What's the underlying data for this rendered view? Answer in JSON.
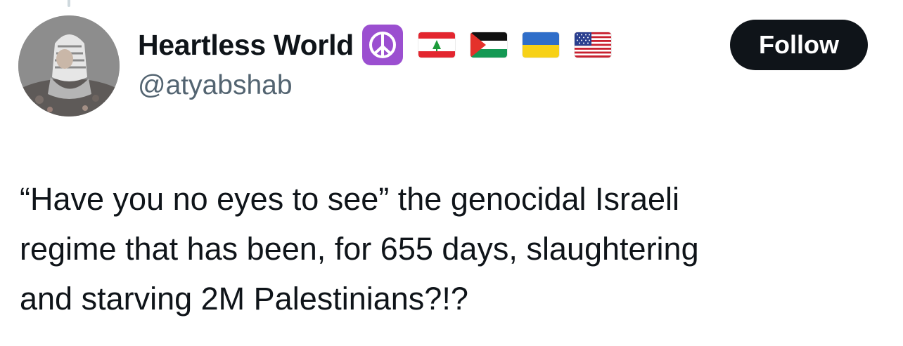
{
  "tweet": {
    "author": {
      "display_name": "Heartless World",
      "handle": "@atyabshab",
      "avatar_icon": "avatar-child-image",
      "name_badges": [
        "peace-symbol-icon",
        "lebanon-flag-icon",
        "palestine-flag-icon",
        "ukraine-flag-icon",
        "usa-flag-icon"
      ]
    },
    "follow_label": "Follow",
    "text_lines": [
      "“Have you no eyes to see” the genocidal Israeli",
      "regime that has been, for 655 days, slaughtering",
      "and starving 2M Palestinians?!?"
    ]
  },
  "colors": {
    "text_primary": "#0f1419",
    "text_secondary": "#536471",
    "follow_bg": "#0f1419",
    "peace_badge": "#9b4fd0"
  }
}
